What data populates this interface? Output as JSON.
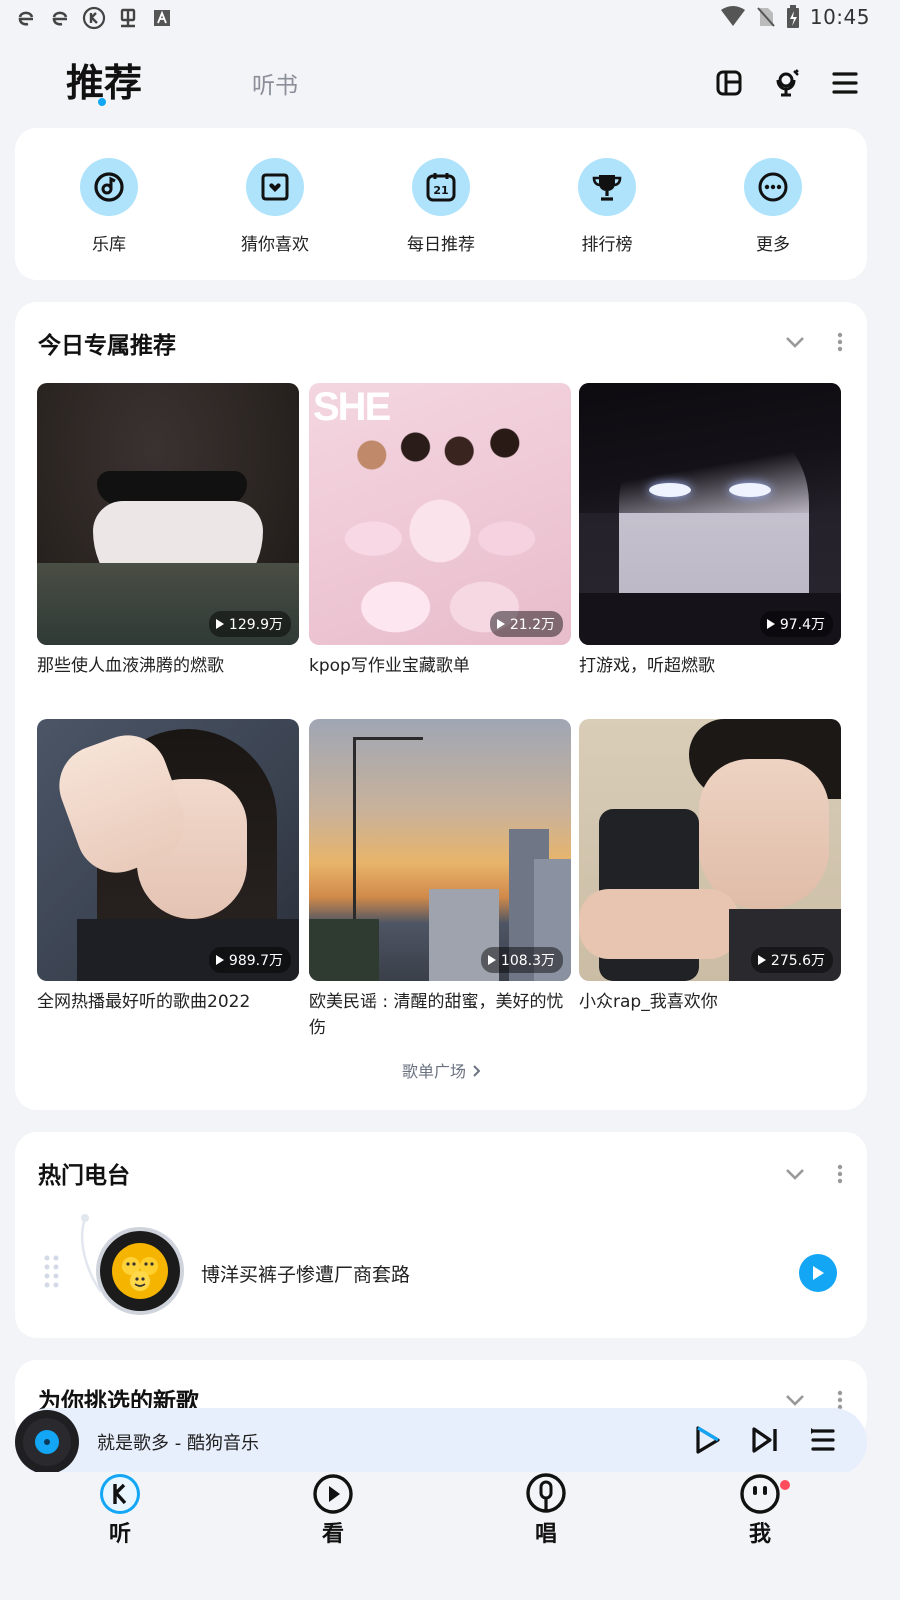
{
  "status_bar": {
    "left_icons": [
      "e-icon",
      "e-icon",
      "kugou-k-icon",
      "bug-icon",
      "a-icon"
    ],
    "time": "10:45"
  },
  "header": {
    "tabs": [
      {
        "label": "推荐",
        "active": true
      },
      {
        "label": "听书",
        "active": false
      }
    ]
  },
  "quick_links": [
    {
      "label": "乐库",
      "icon": "music-library-icon"
    },
    {
      "label": "猜你喜欢",
      "icon": "guess-like-icon"
    },
    {
      "label": "每日推荐",
      "icon": "calendar-icon",
      "badge": "21"
    },
    {
      "label": "排行榜",
      "icon": "trophy-icon"
    },
    {
      "label": "更多",
      "icon": "more-icon"
    }
  ],
  "playlist_section": {
    "title": "今日专属推荐",
    "items": [
      {
        "title": "那些使人血液沸腾的燃歌",
        "plays": "129.9万"
      },
      {
        "title": "kpop写作业宝藏歌单",
        "plays": "21.2万"
      },
      {
        "title": "打游戏，听超燃歌",
        "plays": "97.4万"
      },
      {
        "title": "全网热播最好听的歌曲2022",
        "plays": "989.7万"
      },
      {
        "title": "欧美民谣 : 清醒的甜蜜，美好的忧伤",
        "plays": "108.3万"
      },
      {
        "title": "小众rap_我喜欢你",
        "plays": "275.6万"
      }
    ],
    "more_link": "歌单广场"
  },
  "radio_section": {
    "title": "热门电台",
    "station_title": "博洋买裤子惨遭厂商套路"
  },
  "new_songs_section": {
    "title": "为你挑选的新歌"
  },
  "mini_player": {
    "title": "就是歌多  -  酷狗音乐"
  },
  "bottom_nav": [
    {
      "label": "听",
      "icon": "kugou-listen-icon"
    },
    {
      "label": "看",
      "icon": "play-circle-icon"
    },
    {
      "label": "唱",
      "icon": "microphone-icon"
    },
    {
      "label": "我",
      "icon": "profile-face-icon"
    }
  ],
  "colors": {
    "accent": "#12a6f5",
    "icon_bg": "#aee3fb",
    "page_bg": "#f3f4f7",
    "badge": "#ff4d5e"
  }
}
